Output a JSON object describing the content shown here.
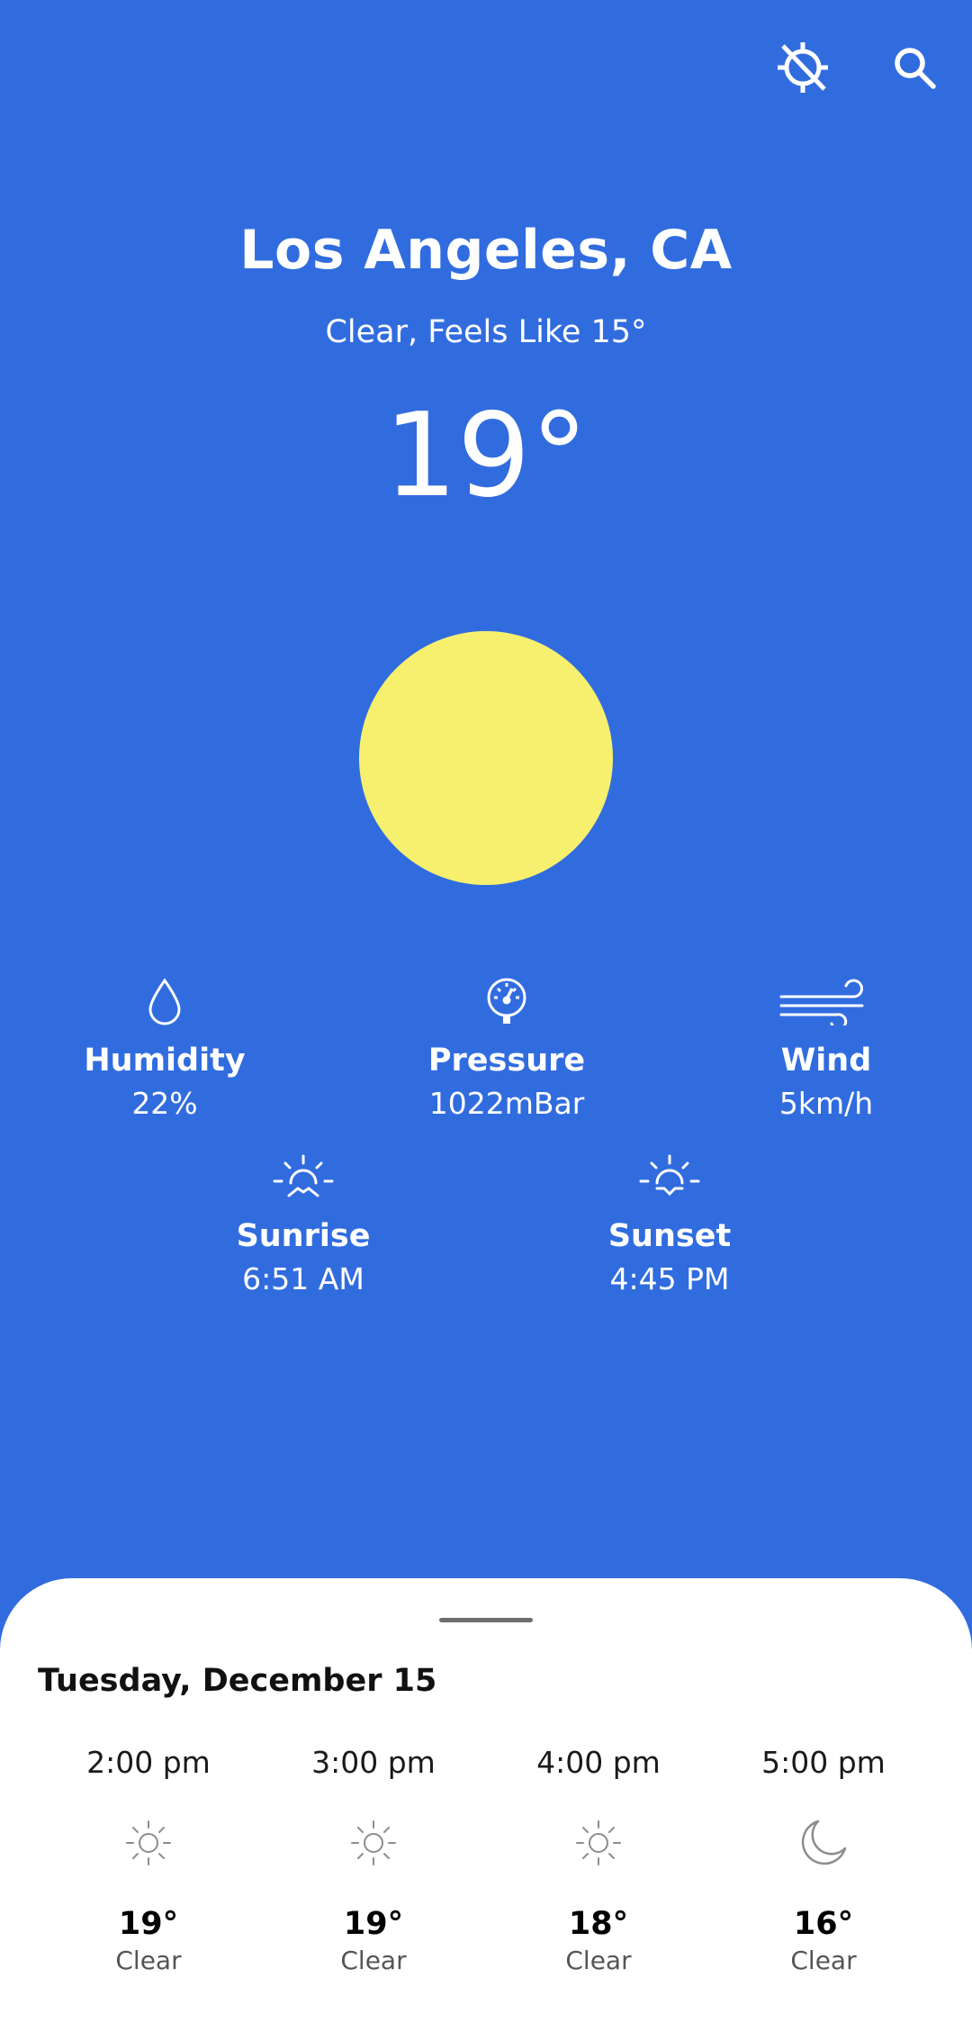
{
  "header": {
    "city": "Los Angeles, CA",
    "condition": "Clear, Feels Like 15°",
    "temperature": "19°"
  },
  "topbar": {
    "location_icon": "location-off-icon",
    "search_icon": "search-icon"
  },
  "colors": {
    "background": "#316cdf",
    "sun": "#f7f06e",
    "sheet": "#ffffff"
  },
  "stats": {
    "humidity": {
      "label": "Humidity",
      "value": "22%",
      "icon": "water-drop-icon"
    },
    "pressure": {
      "label": "Pressure",
      "value": "1022mBar",
      "icon": "gauge-icon"
    },
    "wind": {
      "label": "Wind",
      "value": "5km/h",
      "icon": "wind-icon"
    },
    "sunrise": {
      "label": "Sunrise",
      "value": "6:51 AM",
      "icon": "sunrise-icon"
    },
    "sunset": {
      "label": "Sunset",
      "value": "4:45 PM",
      "icon": "sunset-icon"
    }
  },
  "forecast": {
    "date": "Tuesday, December 15",
    "hours": [
      {
        "time": "2:00 pm",
        "temp": "19°",
        "condition": "Clear",
        "icon": "sun-icon"
      },
      {
        "time": "3:00 pm",
        "temp": "19°",
        "condition": "Clear",
        "icon": "sun-icon"
      },
      {
        "time": "4:00 pm",
        "temp": "18°",
        "condition": "Clear",
        "icon": "sun-icon"
      },
      {
        "time": "5:00 pm",
        "temp": "16°",
        "condition": "Clear",
        "icon": "moon-icon"
      }
    ]
  }
}
